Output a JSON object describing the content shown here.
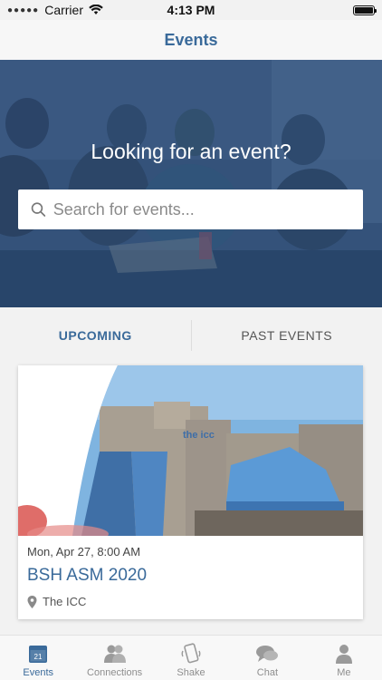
{
  "status_bar": {
    "carrier": "Carrier",
    "time": "4:13 PM"
  },
  "nav": {
    "title": "Events"
  },
  "hero": {
    "title": "Looking for an event?"
  },
  "search": {
    "placeholder": "Search for events..."
  },
  "tabs": [
    {
      "label": "UPCOMING",
      "active": true
    },
    {
      "label": "PAST EVENTS",
      "active": false
    }
  ],
  "events": [
    {
      "date": "Mon, Apr 27, 8:00 AM",
      "title": "BSH ASM 2020",
      "venue": "The ICC",
      "building_sign": "the icc"
    }
  ],
  "tab_bar": {
    "items": [
      {
        "label": "Events",
        "icon": "calendar-icon",
        "active": true,
        "icon_text": "21"
      },
      {
        "label": "Connections",
        "icon": "people-icon",
        "active": false
      },
      {
        "label": "Shake",
        "icon": "shake-phone-icon",
        "active": false
      },
      {
        "label": "Chat",
        "icon": "chat-bubbles-icon",
        "active": false
      },
      {
        "label": "Me",
        "icon": "person-icon",
        "active": false
      }
    ]
  },
  "colors": {
    "accent": "#3a6a9a",
    "hero_overlay": "#2f4d73",
    "tab_inactive": "#8e8e8e"
  }
}
